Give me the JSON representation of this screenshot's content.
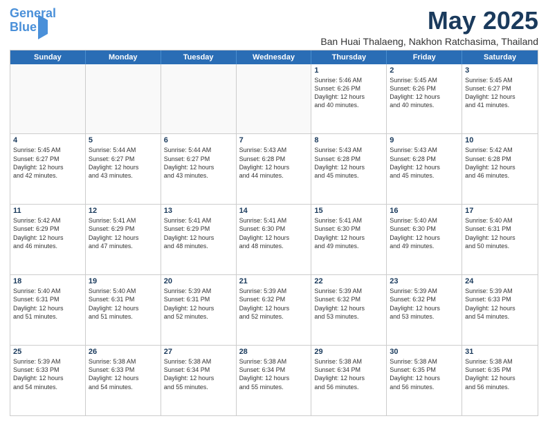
{
  "logo": {
    "line1": "General",
    "line2": "Blue"
  },
  "title": "May 2025",
  "location": "Ban Huai Thalaeng, Nakhon Ratchasima, Thailand",
  "headers": [
    "Sunday",
    "Monday",
    "Tuesday",
    "Wednesday",
    "Thursday",
    "Friday",
    "Saturday"
  ],
  "weeks": [
    [
      {
        "day": "",
        "text": ""
      },
      {
        "day": "",
        "text": ""
      },
      {
        "day": "",
        "text": ""
      },
      {
        "day": "",
        "text": ""
      },
      {
        "day": "1",
        "text": "Sunrise: 5:46 AM\nSunset: 6:26 PM\nDaylight: 12 hours\nand 40 minutes."
      },
      {
        "day": "2",
        "text": "Sunrise: 5:45 AM\nSunset: 6:26 PM\nDaylight: 12 hours\nand 40 minutes."
      },
      {
        "day": "3",
        "text": "Sunrise: 5:45 AM\nSunset: 6:27 PM\nDaylight: 12 hours\nand 41 minutes."
      }
    ],
    [
      {
        "day": "4",
        "text": "Sunrise: 5:45 AM\nSunset: 6:27 PM\nDaylight: 12 hours\nand 42 minutes."
      },
      {
        "day": "5",
        "text": "Sunrise: 5:44 AM\nSunset: 6:27 PM\nDaylight: 12 hours\nand 43 minutes."
      },
      {
        "day": "6",
        "text": "Sunrise: 5:44 AM\nSunset: 6:27 PM\nDaylight: 12 hours\nand 43 minutes."
      },
      {
        "day": "7",
        "text": "Sunrise: 5:43 AM\nSunset: 6:28 PM\nDaylight: 12 hours\nand 44 minutes."
      },
      {
        "day": "8",
        "text": "Sunrise: 5:43 AM\nSunset: 6:28 PM\nDaylight: 12 hours\nand 45 minutes."
      },
      {
        "day": "9",
        "text": "Sunrise: 5:43 AM\nSunset: 6:28 PM\nDaylight: 12 hours\nand 45 minutes."
      },
      {
        "day": "10",
        "text": "Sunrise: 5:42 AM\nSunset: 6:28 PM\nDaylight: 12 hours\nand 46 minutes."
      }
    ],
    [
      {
        "day": "11",
        "text": "Sunrise: 5:42 AM\nSunset: 6:29 PM\nDaylight: 12 hours\nand 46 minutes."
      },
      {
        "day": "12",
        "text": "Sunrise: 5:41 AM\nSunset: 6:29 PM\nDaylight: 12 hours\nand 47 minutes."
      },
      {
        "day": "13",
        "text": "Sunrise: 5:41 AM\nSunset: 6:29 PM\nDaylight: 12 hours\nand 48 minutes."
      },
      {
        "day": "14",
        "text": "Sunrise: 5:41 AM\nSunset: 6:30 PM\nDaylight: 12 hours\nand 48 minutes."
      },
      {
        "day": "15",
        "text": "Sunrise: 5:41 AM\nSunset: 6:30 PM\nDaylight: 12 hours\nand 49 minutes."
      },
      {
        "day": "16",
        "text": "Sunrise: 5:40 AM\nSunset: 6:30 PM\nDaylight: 12 hours\nand 49 minutes."
      },
      {
        "day": "17",
        "text": "Sunrise: 5:40 AM\nSunset: 6:31 PM\nDaylight: 12 hours\nand 50 minutes."
      }
    ],
    [
      {
        "day": "18",
        "text": "Sunrise: 5:40 AM\nSunset: 6:31 PM\nDaylight: 12 hours\nand 51 minutes."
      },
      {
        "day": "19",
        "text": "Sunrise: 5:40 AM\nSunset: 6:31 PM\nDaylight: 12 hours\nand 51 minutes."
      },
      {
        "day": "20",
        "text": "Sunrise: 5:39 AM\nSunset: 6:31 PM\nDaylight: 12 hours\nand 52 minutes."
      },
      {
        "day": "21",
        "text": "Sunrise: 5:39 AM\nSunset: 6:32 PM\nDaylight: 12 hours\nand 52 minutes."
      },
      {
        "day": "22",
        "text": "Sunrise: 5:39 AM\nSunset: 6:32 PM\nDaylight: 12 hours\nand 53 minutes."
      },
      {
        "day": "23",
        "text": "Sunrise: 5:39 AM\nSunset: 6:32 PM\nDaylight: 12 hours\nand 53 minutes."
      },
      {
        "day": "24",
        "text": "Sunrise: 5:39 AM\nSunset: 6:33 PM\nDaylight: 12 hours\nand 54 minutes."
      }
    ],
    [
      {
        "day": "25",
        "text": "Sunrise: 5:39 AM\nSunset: 6:33 PM\nDaylight: 12 hours\nand 54 minutes."
      },
      {
        "day": "26",
        "text": "Sunrise: 5:38 AM\nSunset: 6:33 PM\nDaylight: 12 hours\nand 54 minutes."
      },
      {
        "day": "27",
        "text": "Sunrise: 5:38 AM\nSunset: 6:34 PM\nDaylight: 12 hours\nand 55 minutes."
      },
      {
        "day": "28",
        "text": "Sunrise: 5:38 AM\nSunset: 6:34 PM\nDaylight: 12 hours\nand 55 minutes."
      },
      {
        "day": "29",
        "text": "Sunrise: 5:38 AM\nSunset: 6:34 PM\nDaylight: 12 hours\nand 56 minutes."
      },
      {
        "day": "30",
        "text": "Sunrise: 5:38 AM\nSunset: 6:35 PM\nDaylight: 12 hours\nand 56 minutes."
      },
      {
        "day": "31",
        "text": "Sunrise: 5:38 AM\nSunset: 6:35 PM\nDaylight: 12 hours\nand 56 minutes."
      }
    ]
  ]
}
